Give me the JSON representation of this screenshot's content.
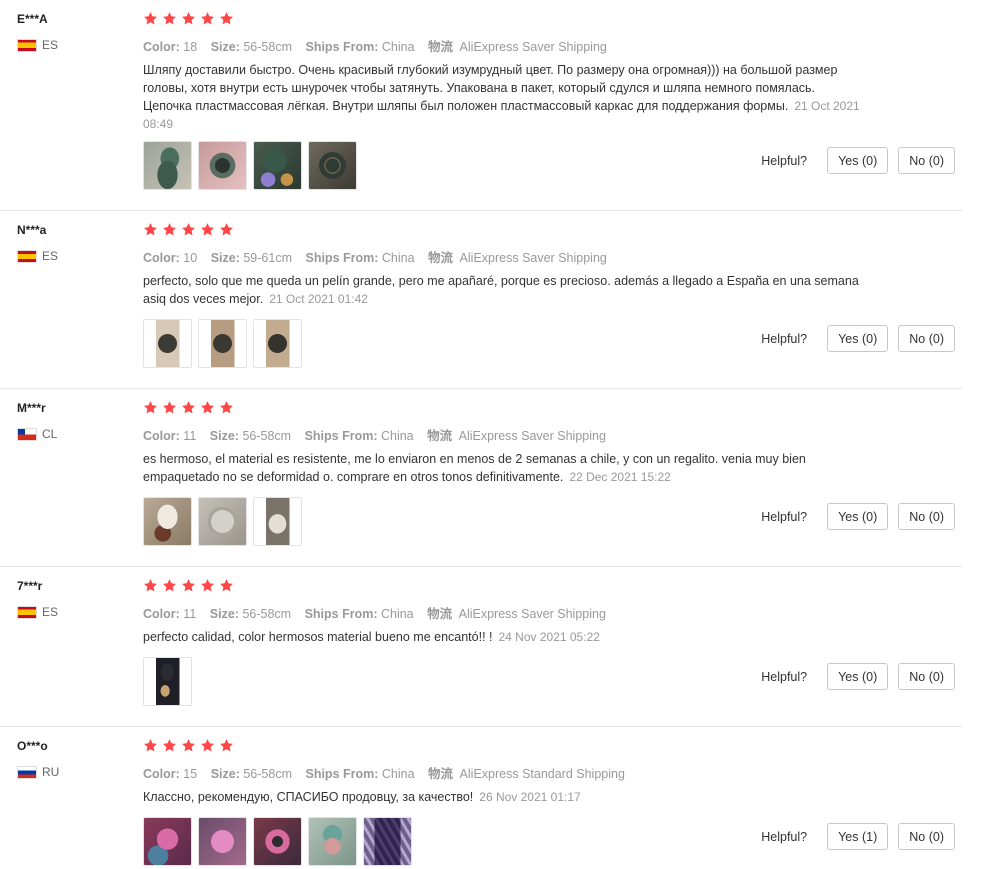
{
  "labels": {
    "color": "Color:",
    "size": "Size:",
    "ships_from": "Ships From:",
    "logistics": "物流",
    "helpful": "Helpful?"
  },
  "accent": {
    "star": "#ff4747"
  },
  "reviews": [
    {
      "user": "E***A",
      "country": "ES",
      "flag_icon": "spain-flag-icon",
      "rating": 5,
      "color": "18",
      "size": "56-58cm",
      "ships_from": "China",
      "logistics": "AliExpress Saver Shipping",
      "content": "Шляпу доставили быстро. Очень красивый глубокий изумрудный цвет. По размеру она огромная))) на большой размер головы, хотя внутри есть шнурочек чтобы затянуть. Упакована в пакет, который сдулся и шляпа немного помялась. Цепочка пластмассовая лёгкая. Внутри шляпы был положен пластмассовый каркас для поддержания формы.",
      "time": "21 Oct 2021 08:49",
      "yes": "Yes (0)",
      "no": "No (0)"
    },
    {
      "user": "N***a",
      "country": "ES",
      "flag_icon": "spain-flag-icon",
      "rating": 5,
      "color": "10",
      "size": "59-61cm",
      "ships_from": "China",
      "logistics": "AliExpress Saver Shipping",
      "content": "perfecto, solo que me queda un pelín grande, pero me apañaré, porque es precioso. además a llegado a España en una semana asiq dos veces mejor.",
      "time": "21 Oct 2021 01:42",
      "yes": "Yes (0)",
      "no": "No (0)"
    },
    {
      "user": "M***r",
      "country": "CL",
      "flag_icon": "chile-flag-icon",
      "rating": 5,
      "color": "11",
      "size": "56-58cm",
      "ships_from": "China",
      "logistics": "AliExpress Saver Shipping",
      "content": "es hermoso, el material es resistente, me lo enviaron en menos de 2 semanas a chile, y con un regalito. venia muy bien empaquetado no se deformidad o. comprare en otros tonos definitivamente.",
      "time": "22 Dec 2021 15:22",
      "yes": "Yes (0)",
      "no": "No (0)"
    },
    {
      "user": "7***r",
      "country": "ES",
      "flag_icon": "spain-flag-icon",
      "rating": 5,
      "color": "11",
      "size": "56-58cm",
      "ships_from": "China",
      "logistics": "AliExpress Saver Shipping",
      "content": "perfecto calidad, color hermosos material bueno me encantó!! !",
      "time": "24 Nov 2021 05:22",
      "yes": "Yes (0)",
      "no": "No (0)"
    },
    {
      "user": "O***o",
      "country": "RU",
      "flag_icon": "russia-flag-icon",
      "rating": 5,
      "color": "15",
      "size": "56-58cm",
      "ships_from": "China",
      "logistics": "AliExpress Standard Shipping",
      "content": "Классно, рекомендую, СПАСИБО продовцу, за качество!",
      "time": "26 Nov 2021 01:17",
      "yes": "Yes (1)",
      "no": "No (0)"
    }
  ]
}
